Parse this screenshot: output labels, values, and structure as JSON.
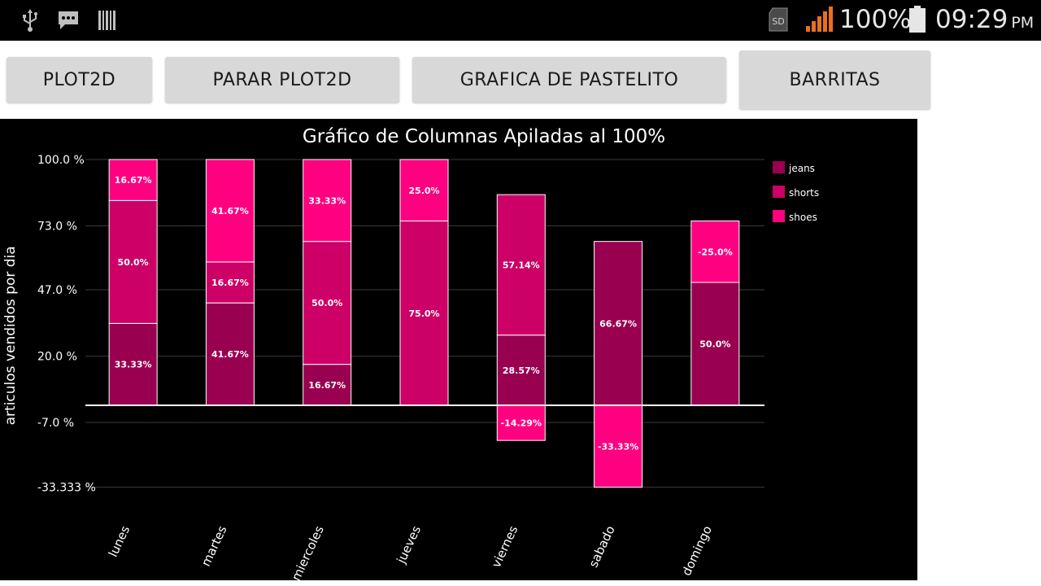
{
  "status_bar": {
    "battery": "100%",
    "time": "09:29",
    "ampm": "PM",
    "icons": [
      "usb-icon",
      "message-icon",
      "barcode-icon",
      "sd-card-icon",
      "signal-icon",
      "battery-icon"
    ],
    "sd_label": "SD",
    "signal_color": "#e8701e"
  },
  "toolbar": {
    "buttons": [
      {
        "label": "PLOT2D"
      },
      {
        "label": "PARAR PLOT2D"
      },
      {
        "label": "GRAFICA DE PASTELITO"
      },
      {
        "label": "BARRITAS"
      }
    ]
  },
  "chart_data": {
    "type": "bar",
    "stacked": true,
    "title": "Gráfico de Columnas Apiladas al 100%",
    "ylabel": "articulos vendidos por dia",
    "xlabel": "",
    "ylim": [
      -33.333,
      100
    ],
    "y_ticks": [
      100,
      73,
      47,
      20,
      -7,
      -33.333
    ],
    "y_tick_labels": [
      "100.0 %",
      "73.0 %",
      "47.0 %",
      "20.0 %",
      "-7.0 %",
      "-33.333 %"
    ],
    "categories": [
      "lunes",
      "martes",
      "miercoles",
      "jueves",
      "viernes",
      "sabado",
      "domingo"
    ],
    "series": [
      {
        "name": "jeans",
        "color": "#990050",
        "values": [
          33.33,
          41.67,
          16.67,
          0,
          28.57,
          66.67,
          50.0
        ],
        "labels": [
          "33.33%",
          "41.67%",
          "16.67%",
          "",
          "28.57%",
          "66.67%",
          "50.0%"
        ]
      },
      {
        "name": "shorts",
        "color": "#cc0066",
        "values": [
          50.0,
          16.67,
          50.0,
          75.0,
          57.14,
          0,
          0
        ],
        "labels": [
          "50.0%",
          "16.67%",
          "50.0%",
          "75.0%",
          "57.14%",
          "",
          ""
        ]
      },
      {
        "name": "shoes",
        "color": "#ff0080",
        "values": [
          16.67,
          41.67,
          33.33,
          25.0,
          -14.29,
          -33.33,
          25.0
        ],
        "labels": [
          "16.67%",
          "41.67%",
          "33.33%",
          "25.0%",
          "-14.29%",
          "-33.33%",
          "-25.0%"
        ]
      }
    ],
    "grid": true,
    "legend": "right",
    "colors": {
      "background": "#000000",
      "grid": "#3a3a3a",
      "text": "#ffffff",
      "bar_border": "#ffffff"
    }
  }
}
